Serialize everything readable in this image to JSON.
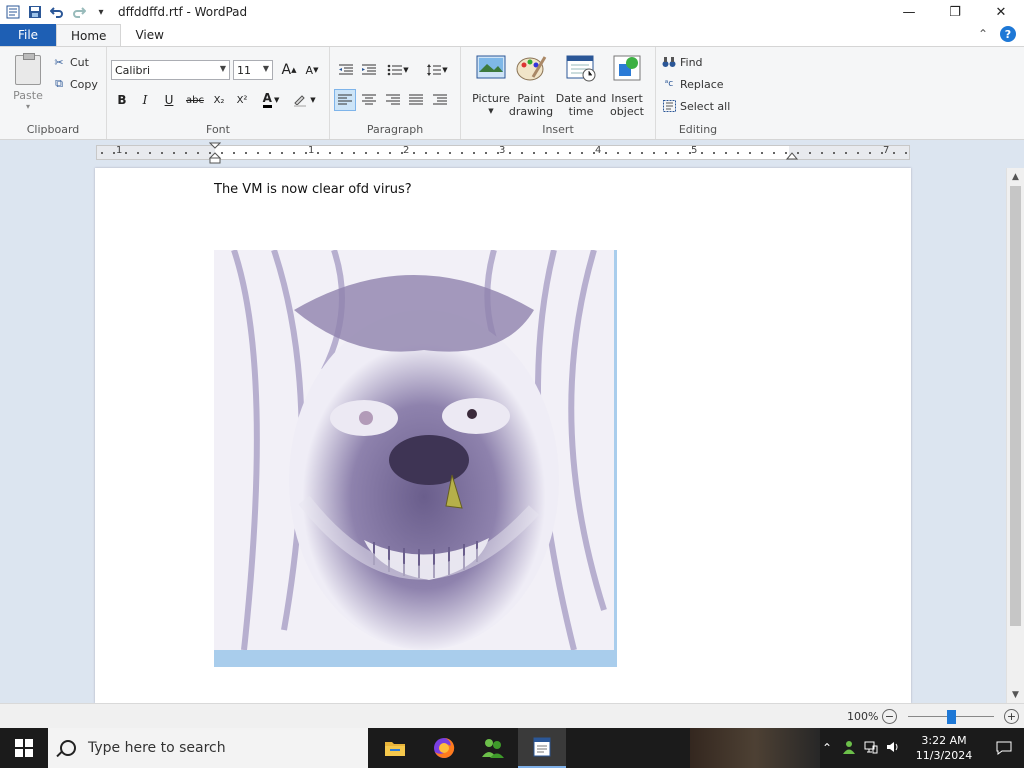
{
  "window": {
    "title": "dffddffd.rtf - WordPad",
    "minimize": "—",
    "maximize": "❐",
    "close": "✕"
  },
  "ribbon_tabs": [
    {
      "label": "File"
    },
    {
      "label": "Home"
    },
    {
      "label": "View"
    }
  ],
  "help": {
    "collapse": "⌃",
    "help": "?"
  },
  "clipboard": {
    "paste": "Paste",
    "cut": "Cut",
    "copy": "Copy",
    "group": "Clipboard"
  },
  "font": {
    "family": "Calibri",
    "size": "11",
    "grow": "A",
    "shrink": "A",
    "bold": "B",
    "italic": "I",
    "underline": "U",
    "strike": "abc",
    "subscript": "X₂",
    "superscript": "X²",
    "color": "A",
    "group": "Font"
  },
  "paragraph": {
    "group": "Paragraph"
  },
  "insert": {
    "picture": "Picture",
    "paint_line1": "Paint",
    "paint_line2": "drawing",
    "datetime_line1": "Date and",
    "datetime_line2": "time",
    "object_line1": "Insert",
    "object_line2": "object",
    "group": "Insert"
  },
  "editing": {
    "find": "Find",
    "replace": "Replace",
    "select_all": "Select all",
    "group": "Editing"
  },
  "ruler": {
    "numbers": [
      "1",
      "1",
      "2",
      "3",
      "4",
      "5",
      "7"
    ]
  },
  "document": {
    "text": "The VM is now clear ofd virus?"
  },
  "status": {
    "zoom": "100%",
    "zoom_level": 0.5,
    "zoom_out": "−",
    "zoom_in": "+"
  },
  "taskbar": {
    "search_placeholder": "Type here to search",
    "time": "3:22 AM",
    "date": "11/3/2024"
  },
  "colors": {
    "accent": "#1e5fb4",
    "ribbon_bg": "#f5f6f7",
    "doc_bg": "#dce5f0",
    "taskbar": "#1b1b1b"
  }
}
